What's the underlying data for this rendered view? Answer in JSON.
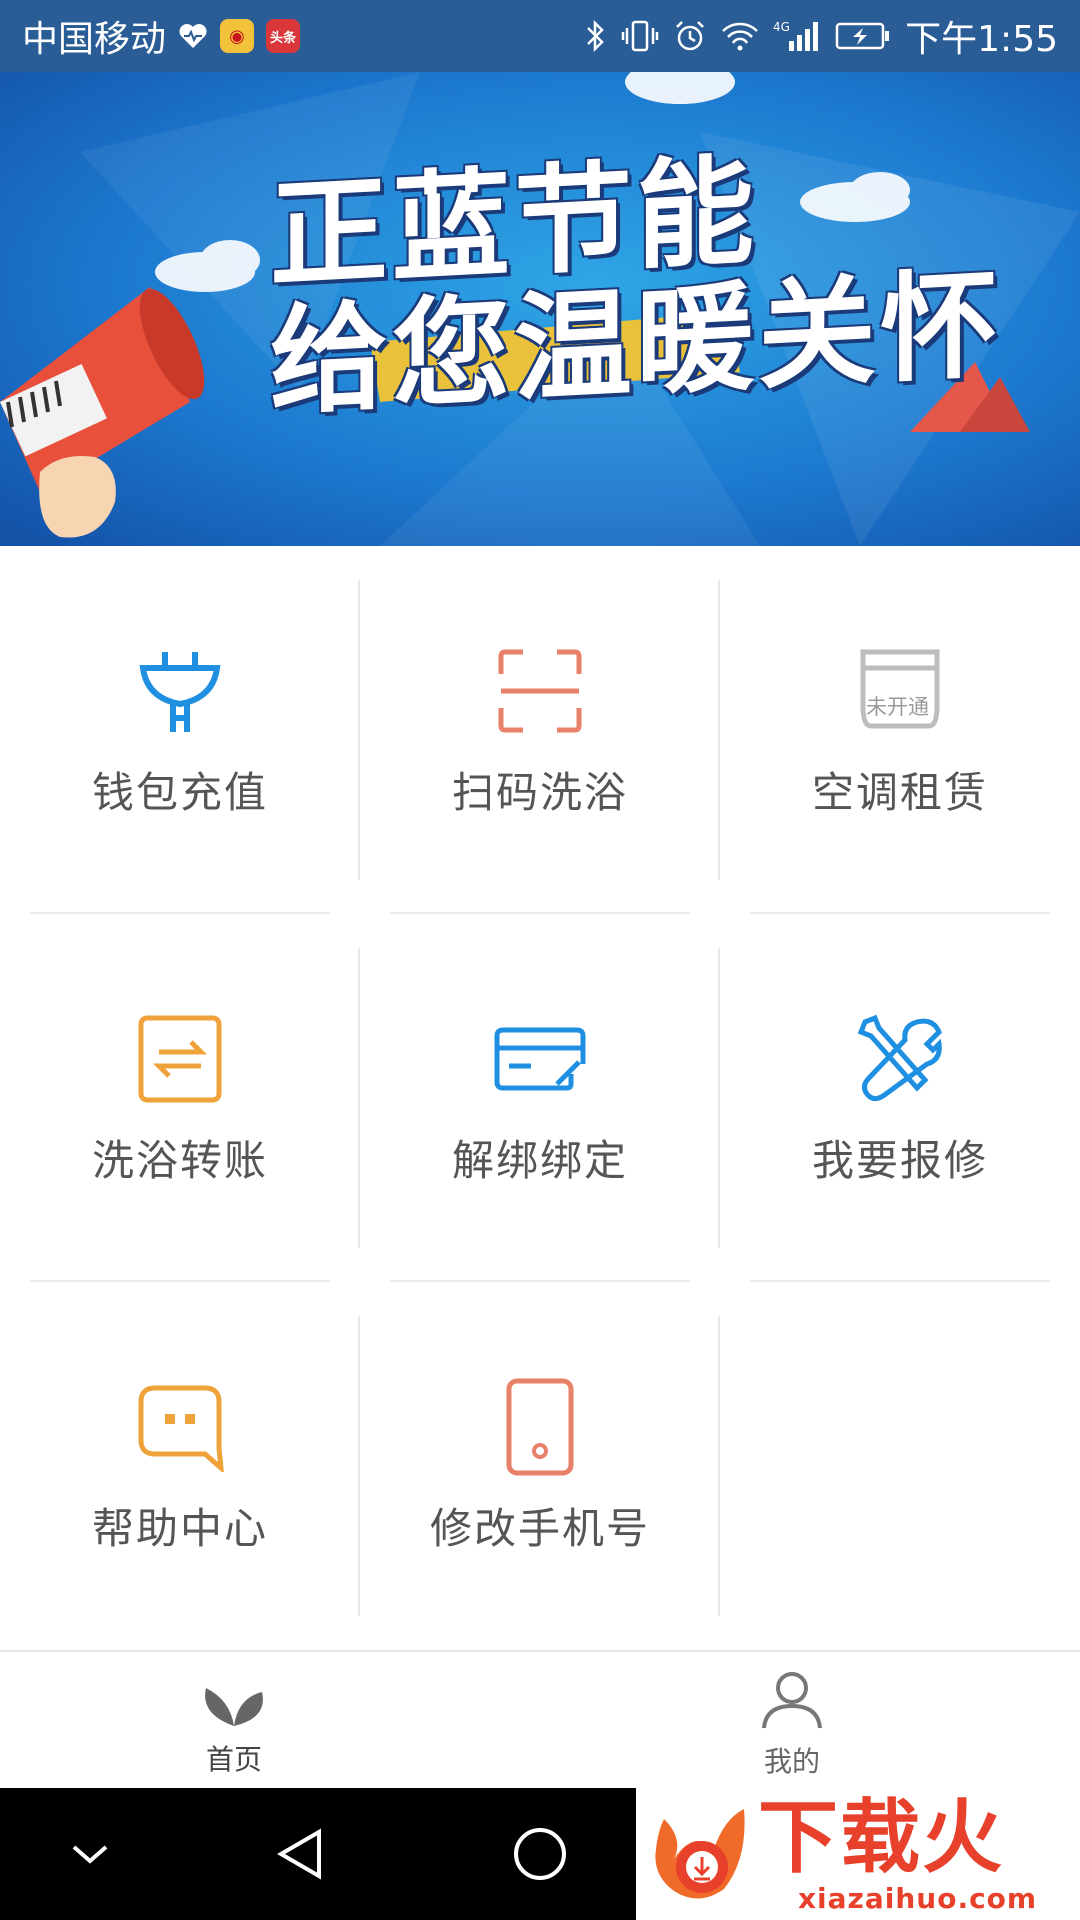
{
  "status_bar": {
    "carrier": "中国移动",
    "toutiao_badge": "头条",
    "network": "4G",
    "time": "下午1:55"
  },
  "banner": {
    "line1": "正蓝节能",
    "line2": "给您温暖关怀"
  },
  "grid": {
    "items": [
      {
        "label": "钱包充值",
        "icon": "plug-icon",
        "color": "#1e8fe1"
      },
      {
        "label": "扫码洗浴",
        "icon": "scan-icon",
        "color": "#e8806a"
      },
      {
        "label": "空调租赁",
        "icon": "air-conditioner-icon",
        "color": "#bdbdbd",
        "badge": "未开通"
      },
      {
        "label": "洗浴转账",
        "icon": "transfer-icon",
        "color": "#f0a23a"
      },
      {
        "label": "解绑绑定",
        "icon": "card-link-icon",
        "color": "#1e8fe1"
      },
      {
        "label": "我要报修",
        "icon": "repair-tools-icon",
        "color": "#1e8fe1"
      },
      {
        "label": "帮助中心",
        "icon": "chat-bubble-icon",
        "color": "#f0a23a"
      },
      {
        "label": "修改手机号",
        "icon": "phone-icon",
        "color": "#e8806a"
      }
    ]
  },
  "tabbar": {
    "home_label": "首页",
    "mine_label": "我的"
  },
  "watermark": {
    "title": "下载火",
    "url": "xiazaihuo.com"
  }
}
